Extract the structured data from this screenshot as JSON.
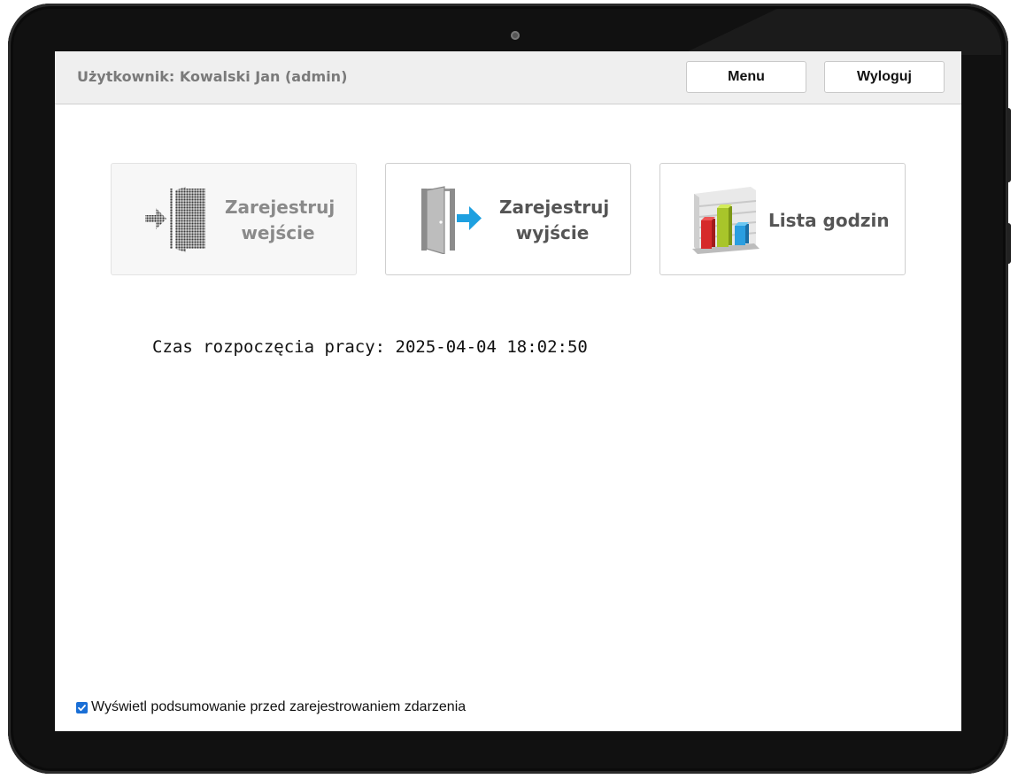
{
  "header": {
    "user_label": "Użytkownik: Kowalski Jan (admin)",
    "menu_label": "Menu",
    "logout_label": "Wyloguj"
  },
  "tiles": [
    {
      "line1": "Zarejestruj",
      "line2": "wejście",
      "icon": "enter-door-icon",
      "enabled": false
    },
    {
      "line1": "Zarejestruj",
      "line2": "wyjście",
      "icon": "exit-door-icon",
      "enabled": true
    },
    {
      "line1": "Lista godzin",
      "icon": "bar-chart-icon",
      "enabled": true
    }
  ],
  "status": {
    "start_time_text": "Czas rozpoczęcia pracy: 2025-04-04 18:02:50"
  },
  "footer": {
    "summary_option_label": "Wyświetl podsumowanie przed zarejestrowaniem zdarzenia",
    "summary_option_checked": true
  },
  "colors": {
    "accent_arrow": "#1ea0e0",
    "checkbox": "#1a6fd6",
    "device_bezel": "#111111"
  }
}
